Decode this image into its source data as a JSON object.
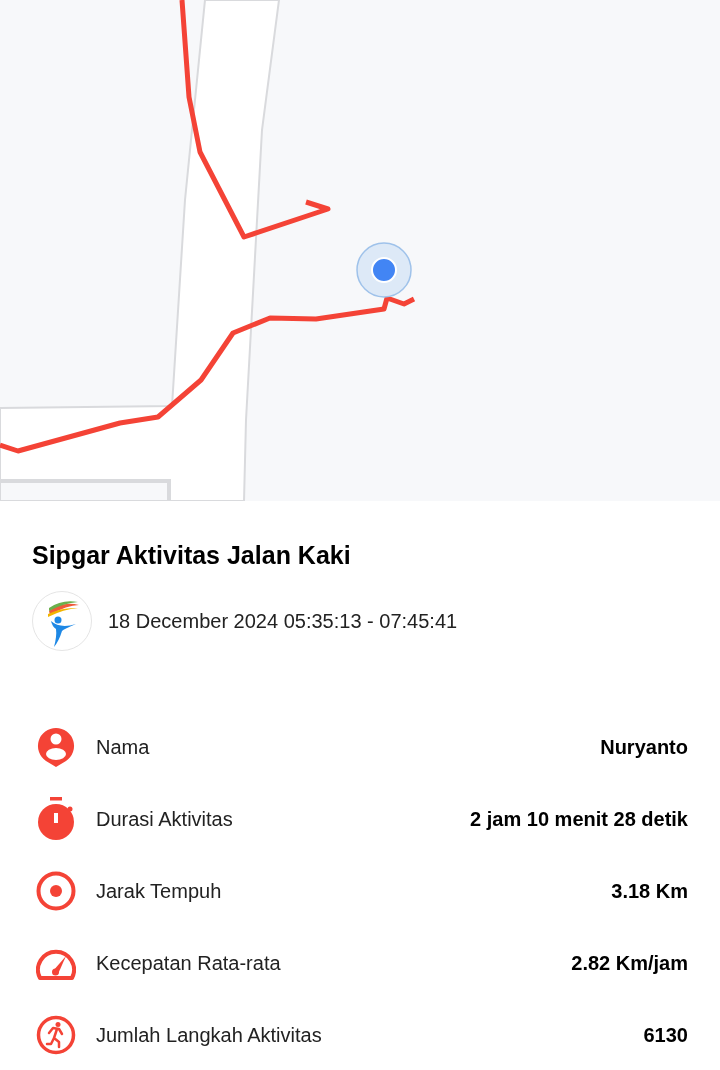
{
  "title": "Sipgar Aktivitas Jalan Kaki",
  "datetime": "18 December 2024 05:35:13 - 07:45:41",
  "stats": [
    {
      "kind": "person",
      "label": "Nama",
      "value": "Nuryanto"
    },
    {
      "kind": "timer",
      "label": "Durasi Aktivitas",
      "value": "2 jam 10 menit 28 detik"
    },
    {
      "kind": "target",
      "label": "Jarak Tempuh",
      "value": "3.18 Km"
    },
    {
      "kind": "speed",
      "label": "Kecepatan Rata-rata",
      "value": "2.82 Km/jam"
    },
    {
      "kind": "steps",
      "label": "Jumlah Langkah Aktivitas",
      "value": "6130"
    }
  ]
}
